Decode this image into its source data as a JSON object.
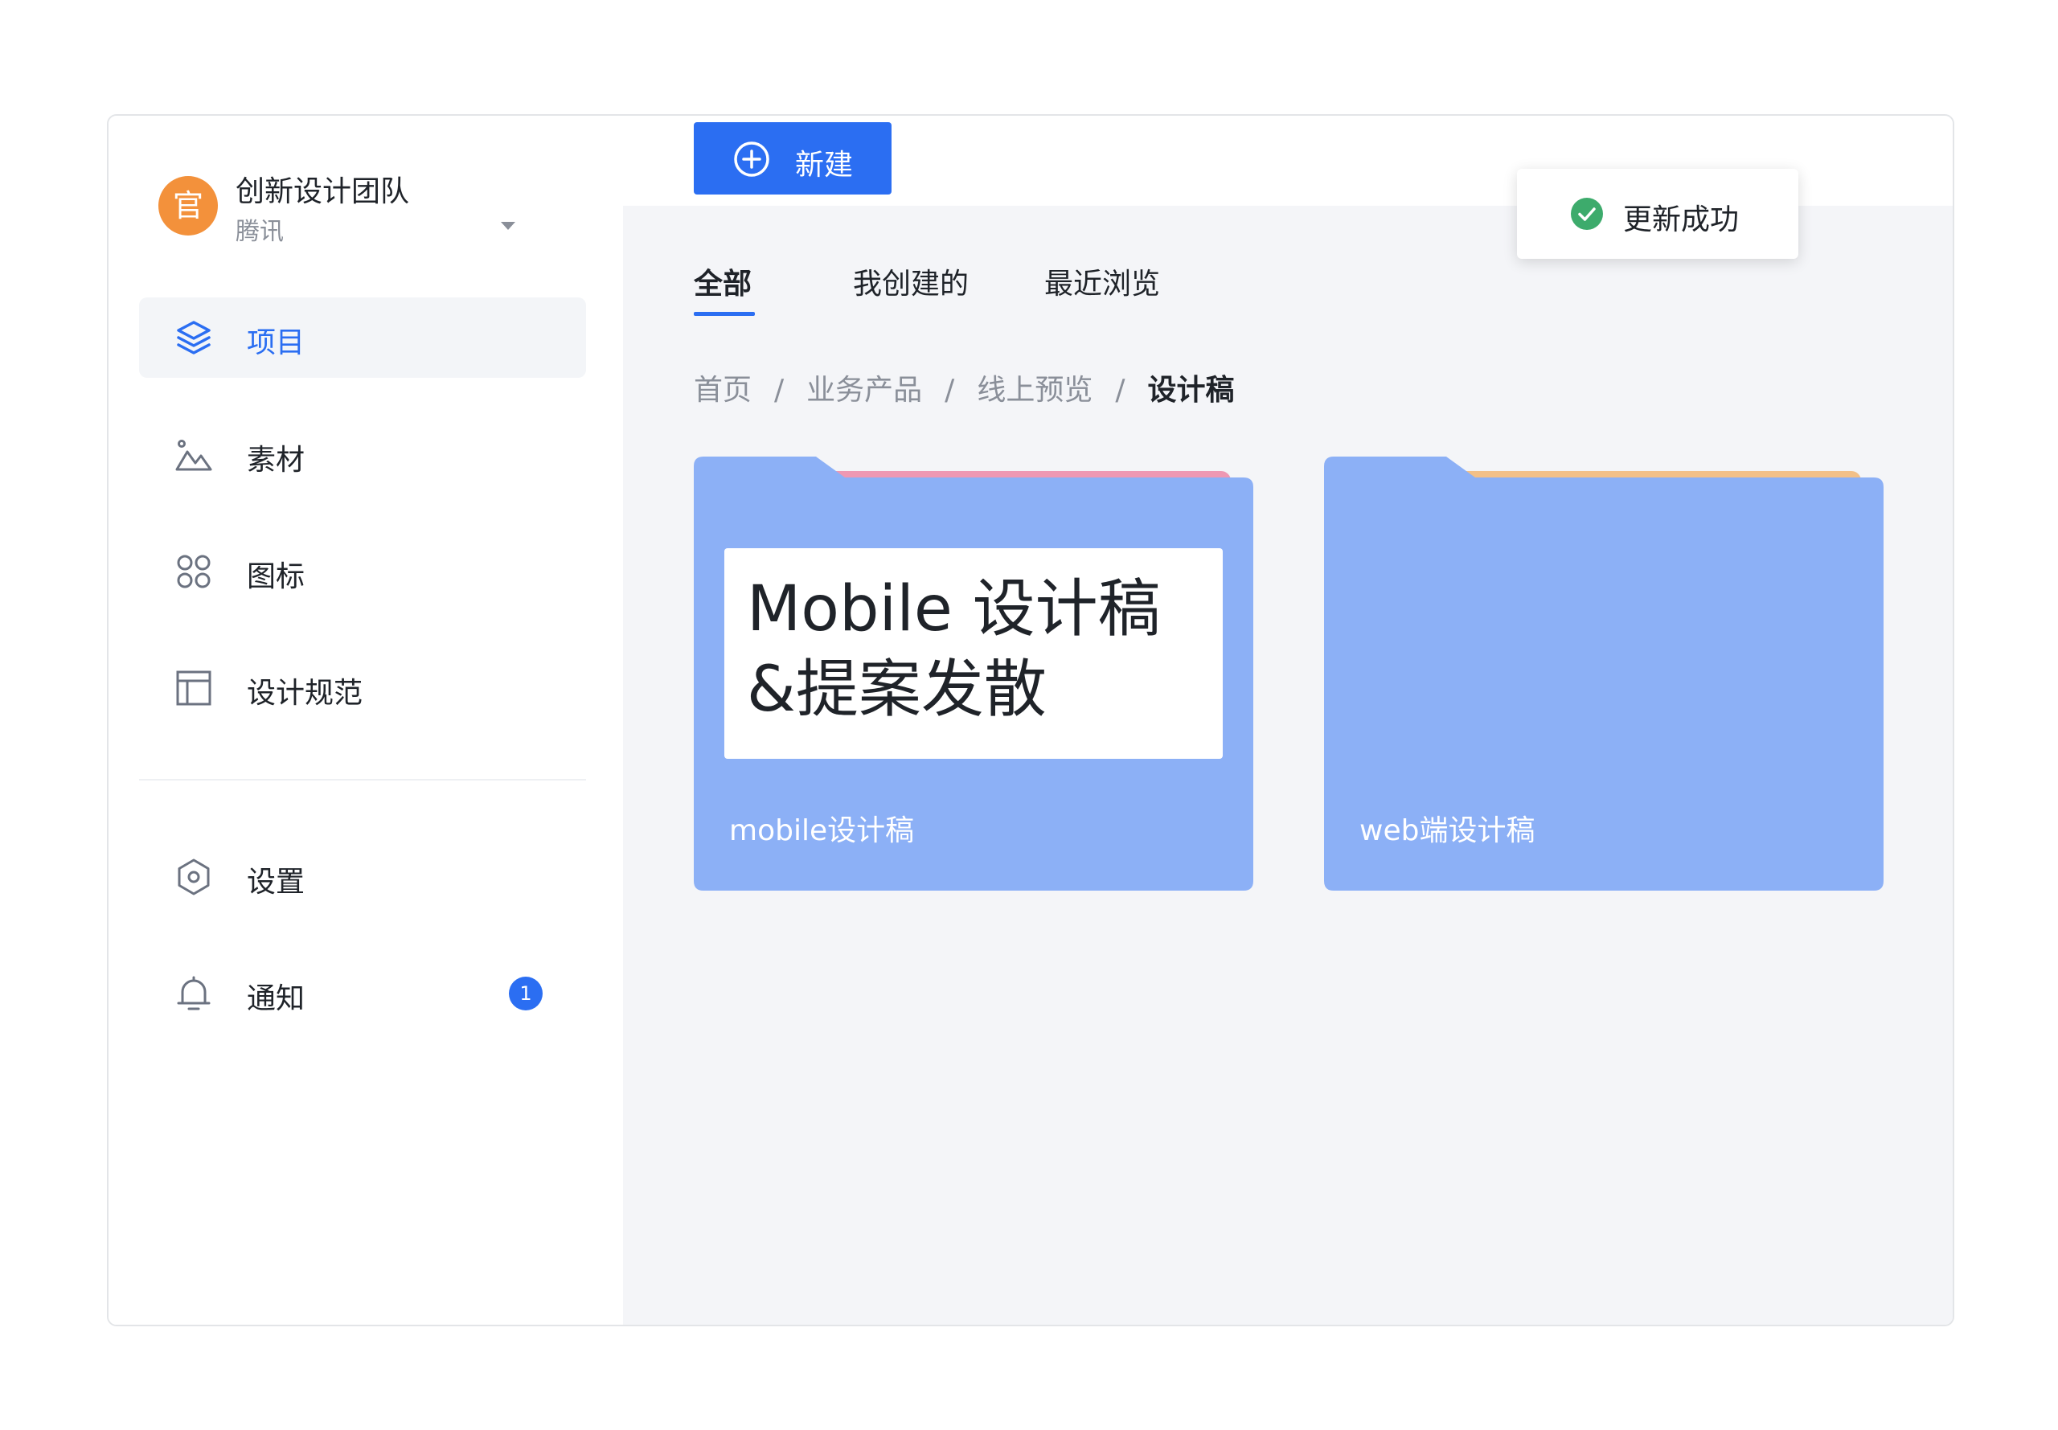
{
  "team": {
    "avatar_text": "官",
    "name": "创新设计团队",
    "subtitle": "腾讯"
  },
  "sidebar": {
    "items": [
      {
        "label": "项目",
        "icon": "layers-icon",
        "active": true
      },
      {
        "label": "素材",
        "icon": "image-icon"
      },
      {
        "label": "图标",
        "icon": "grid-icon"
      },
      {
        "label": "设计规范",
        "icon": "layout-icon"
      }
    ],
    "bottom_items": [
      {
        "label": "设置",
        "icon": "settings-icon"
      },
      {
        "label": "通知",
        "icon": "bell-icon",
        "badge": "1"
      }
    ]
  },
  "toolbar": {
    "new_label": "新建"
  },
  "tabs": [
    {
      "label": "全部",
      "active": true
    },
    {
      "label": "我创建的"
    },
    {
      "label": "最近浏览"
    }
  ],
  "breadcrumb": {
    "items": [
      "首页",
      "业务产品",
      "线上预览"
    ],
    "separator": "/",
    "current": "设计稿"
  },
  "folders": [
    {
      "name": "mobile设计稿",
      "cover_text": "Mobile 设计稿 &提案发散",
      "tab_color": "#ee98b3"
    },
    {
      "name": "web端设计稿",
      "tab_color": "#f3c088"
    }
  ],
  "toast": {
    "text": "更新成功"
  },
  "colors": {
    "accent": "#2b6ef2",
    "folder": "#8cb0f6",
    "success": "#3dab6c",
    "avatar": "#f3913b"
  }
}
